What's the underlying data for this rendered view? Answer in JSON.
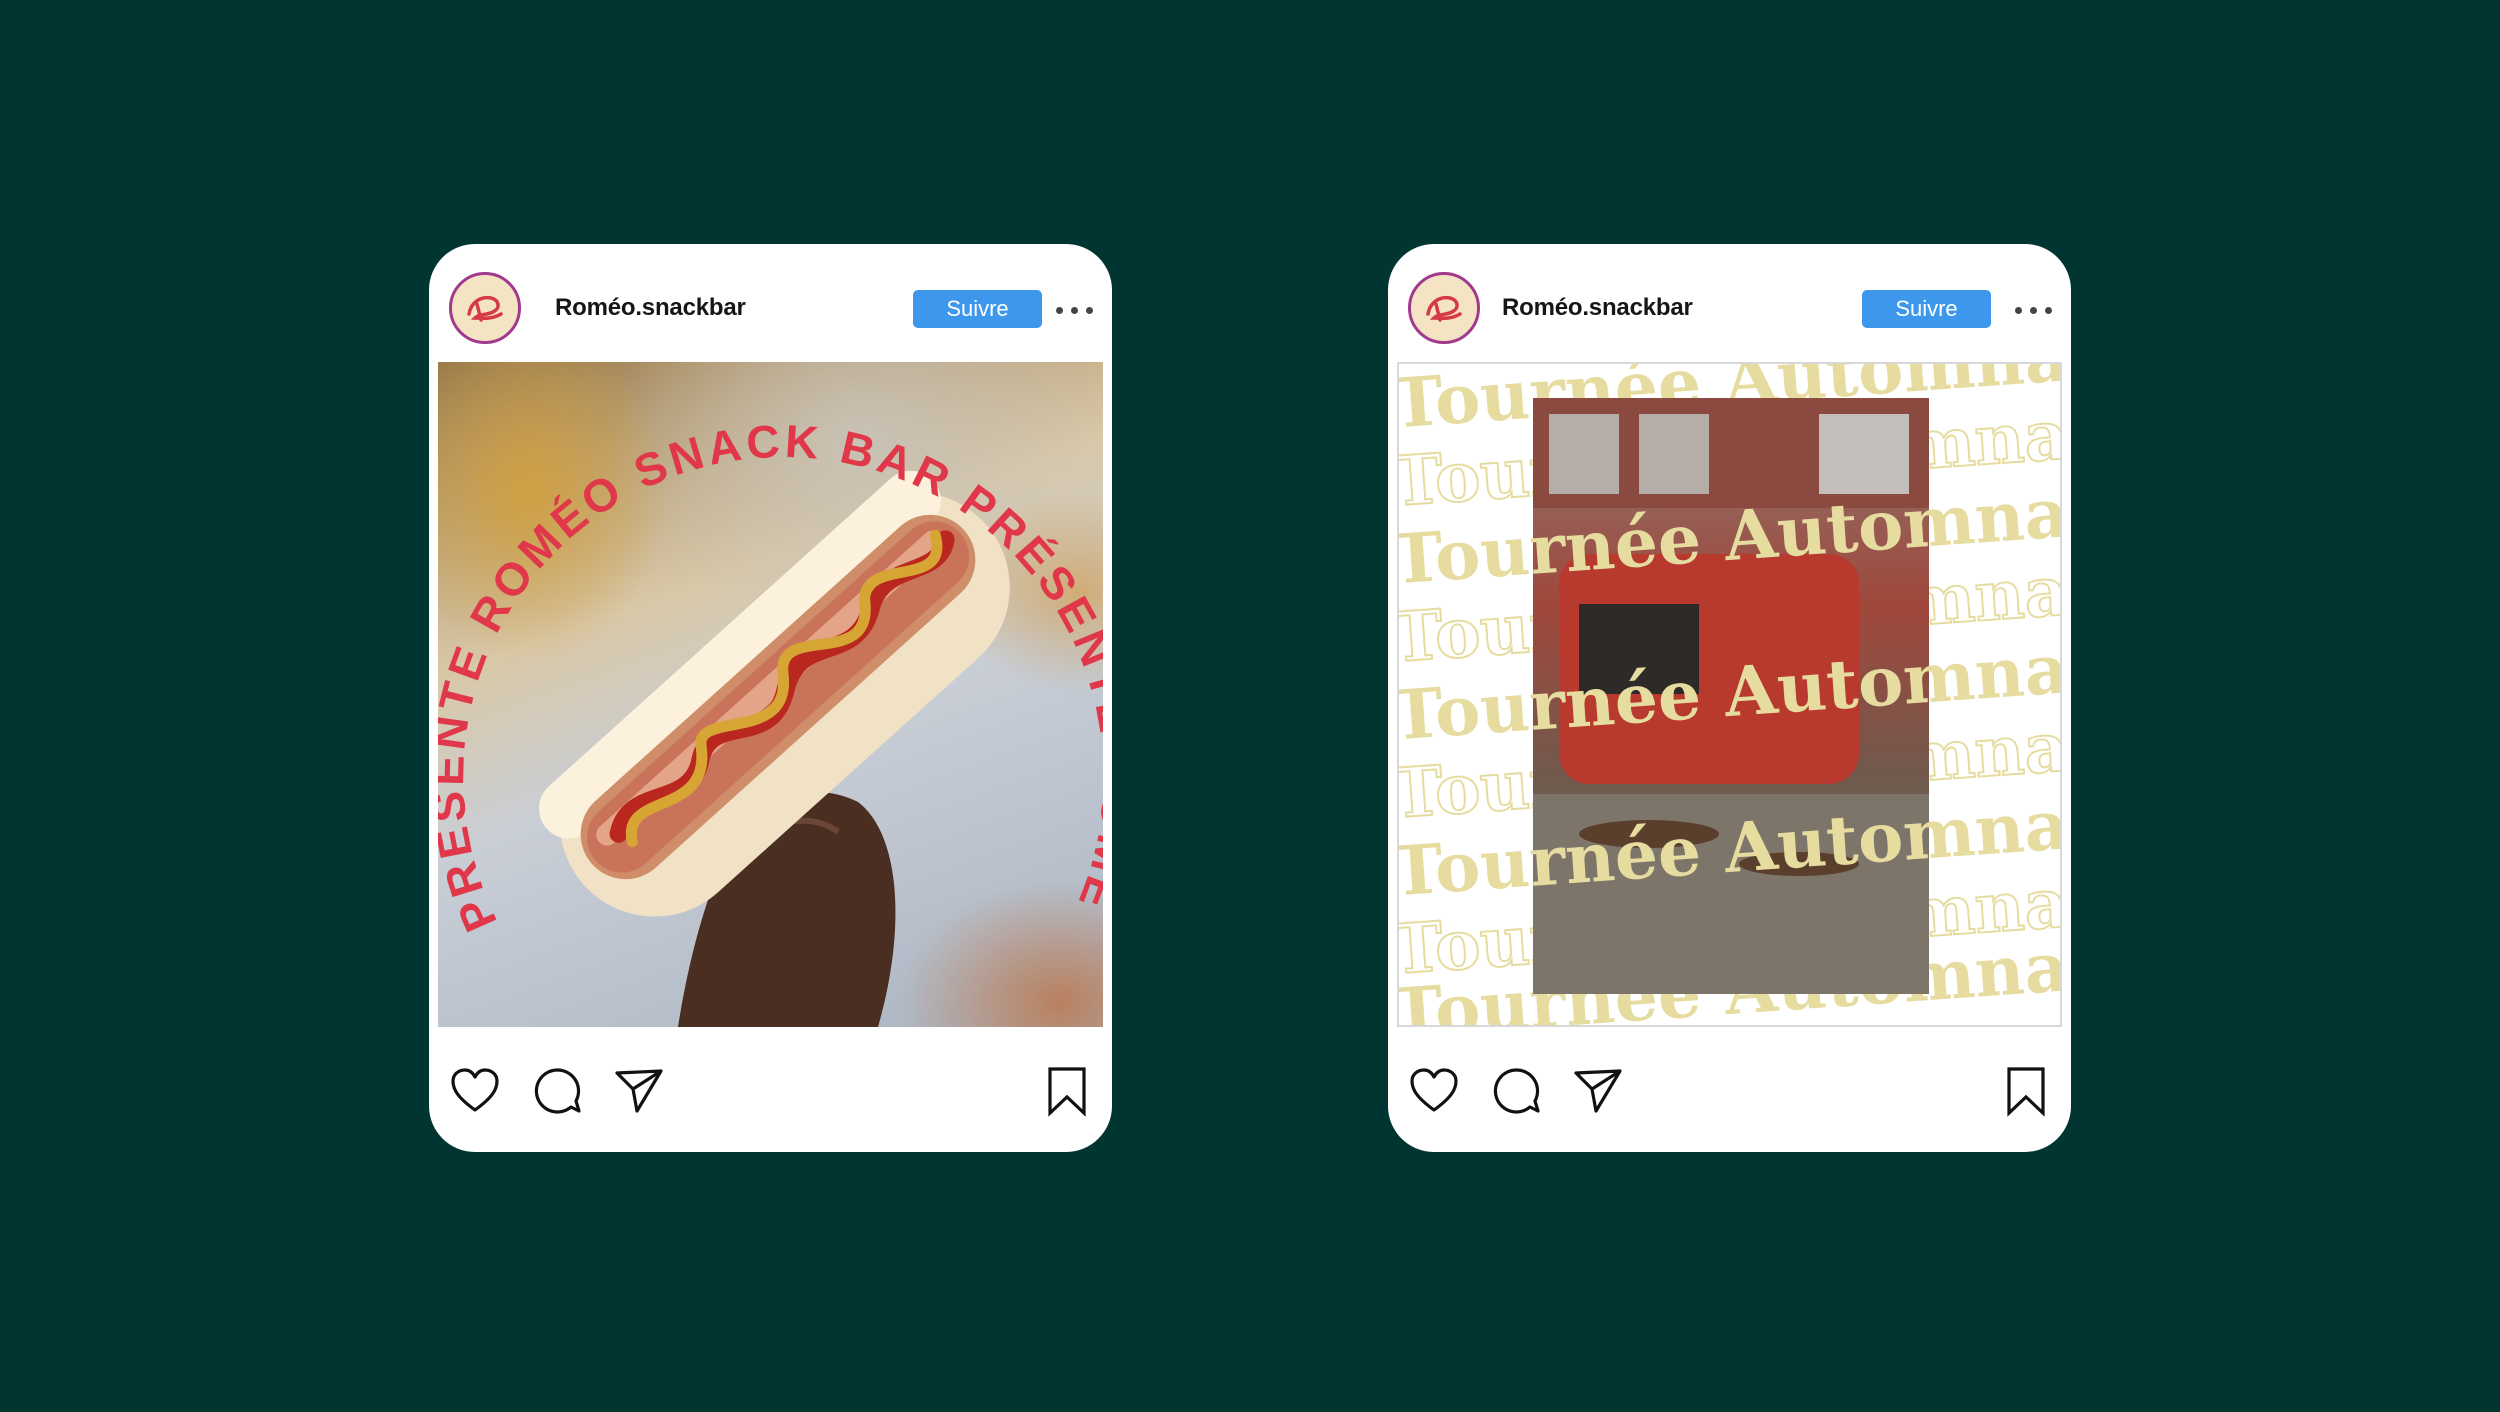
{
  "theme": {
    "background": "#003532",
    "card": "#ffffff",
    "follow_button": "#3d97ec",
    "accent_red": "#e0384a",
    "accent_cream": "#e6dca0"
  },
  "posts": [
    {
      "username": "Roméo.snackbar",
      "follow_label": "Suivre",
      "image_text": "PRÉSENTE ROMÉO SNACK BAR PRÉSENTE ROMÉO SNACK BAR",
      "icons": [
        "heart-icon",
        "comment-icon",
        "share-icon",
        "bookmark-icon"
      ]
    },
    {
      "username": "Roméo.snackbar",
      "follow_label": "Suivre",
      "image_text_1": "Tournée",
      "image_text_2": "Automnale",
      "icons": [
        "heart-icon",
        "comment-icon",
        "share-icon",
        "bookmark-icon"
      ]
    }
  ]
}
